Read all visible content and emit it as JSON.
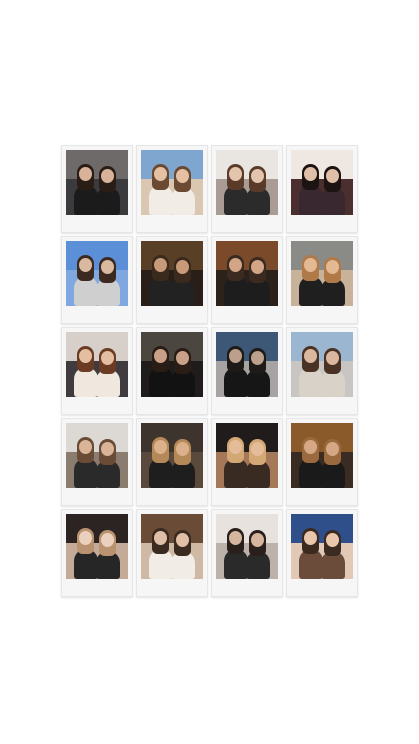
{
  "photos": [
    {
      "name": "photo-city-balcony",
      "sky": "#6f6a6a",
      "ground": "#3b3a3c",
      "hair": "#2a1d16",
      "skin": "#d8b39a",
      "outfit": "#1b1b1b"
    },
    {
      "name": "photo-beach-sunset",
      "sky": "#7fa6cf",
      "ground": "#d9c7b2",
      "hair": "#6b4a33",
      "skin": "#e5c0a3",
      "outfit": "#f1ece6"
    },
    {
      "name": "photo-mirror-selfie",
      "sky": "#e9e6e2",
      "ground": "#a89c94",
      "hair": "#5a3b2a",
      "skin": "#e3c5ad",
      "outfit": "#2b2b2b"
    },
    {
      "name": "photo-hug-portrait",
      "sky": "#efe7e1",
      "ground": "#4a2f2e",
      "hair": "#1c1413",
      "skin": "#e0bfa8",
      "outfit": "#3a2830"
    },
    {
      "name": "photo-heart-hands",
      "sky": "#5b8fd8",
      "ground": "#7fa7e0",
      "hair": "#3c2a20",
      "skin": "#d9b9a0",
      "outfit": "#cfcfcf"
    },
    {
      "name": "photo-party-lights",
      "sky": "#5a3f27",
      "ground": "#2a1f18",
      "hair": "#3a2a1e",
      "skin": "#c99a78",
      "outfit": "#222222"
    },
    {
      "name": "photo-restaurant",
      "sky": "#7a4a2a",
      "ground": "#2b221c",
      "hair": "#3b2a20",
      "skin": "#d1a585",
      "outfit": "#1d1d1d"
    },
    {
      "name": "photo-sunglasses",
      "sky": "#8a8a86",
      "ground": "#c8b29a",
      "hair": "#b07a48",
      "skin": "#e2b993",
      "outfit": "#1f1f1f"
    },
    {
      "name": "photo-cheek-kiss",
      "sky": "#d7cfc9",
      "ground": "#3f3b3e",
      "hair": "#6b3b24",
      "skin": "#e4bea1",
      "outfit": "#f0e7de"
    },
    {
      "name": "photo-night-selfie",
      "sky": "#4c4641",
      "ground": "#1f1c1b",
      "hair": "#2a1d16",
      "skin": "#c9a189",
      "outfit": "#121212"
    },
    {
      "name": "photo-floor-mirror",
      "sky": "#3c5876",
      "ground": "#a6a3a2",
      "hair": "#1e1a18",
      "skin": "#bca08c",
      "outfit": "#161616"
    },
    {
      "name": "photo-ocean-view",
      "sky": "#9bb6d0",
      "ground": "#c9c5c2",
      "hair": "#4a3325",
      "skin": "#dab79e",
      "outfit": "#d9d2c8"
    },
    {
      "name": "photo-bathroom-mirror",
      "sky": "#dcd8d4",
      "ground": "#8b7c70",
      "hair": "#6a4c36",
      "skin": "#d9b499",
      "outfit": "#2a2a2a"
    },
    {
      "name": "photo-dinner-duo",
      "sky": "#3d342d",
      "ground": "#5a4a3c",
      "hair": "#b58858",
      "skin": "#ddb08c",
      "outfit": "#1e1e1e"
    },
    {
      "name": "photo-blonde-drink",
      "sky": "#201c1b",
      "ground": "#a5785a",
      "hair": "#d3a874",
      "skin": "#e4bc99",
      "outfit": "#3a2b22"
    },
    {
      "name": "photo-bar-lounge",
      "sky": "#8a5a2a",
      "ground": "#3a2c22",
      "hair": "#9a6a3e",
      "skin": "#d6a784",
      "outfit": "#1a1a1a"
    },
    {
      "name": "photo-close-up",
      "sky": "#2b2422",
      "ground": "#c4ab97",
      "hair": "#b99270",
      "skin": "#ead0bd",
      "outfit": "#262626"
    },
    {
      "name": "photo-group-table",
      "sky": "#6a4b36",
      "ground": "#cfb9a5",
      "hair": "#3a2a20",
      "skin": "#e1bfa6",
      "outfit": "#f2ece6"
    },
    {
      "name": "photo-heart-reflection",
      "sky": "#e7e2dd",
      "ground": "#bdb2a9",
      "hair": "#2a1f1a",
      "skin": "#d5b59d",
      "outfit": "#2a2a2a"
    },
    {
      "name": "photo-silly-faces",
      "sky": "#2f4f8a",
      "ground": "#e2c9b5",
      "hair": "#3a2a20",
      "skin": "#e8c7ad",
      "outfit": "#6b4b3a"
    }
  ]
}
